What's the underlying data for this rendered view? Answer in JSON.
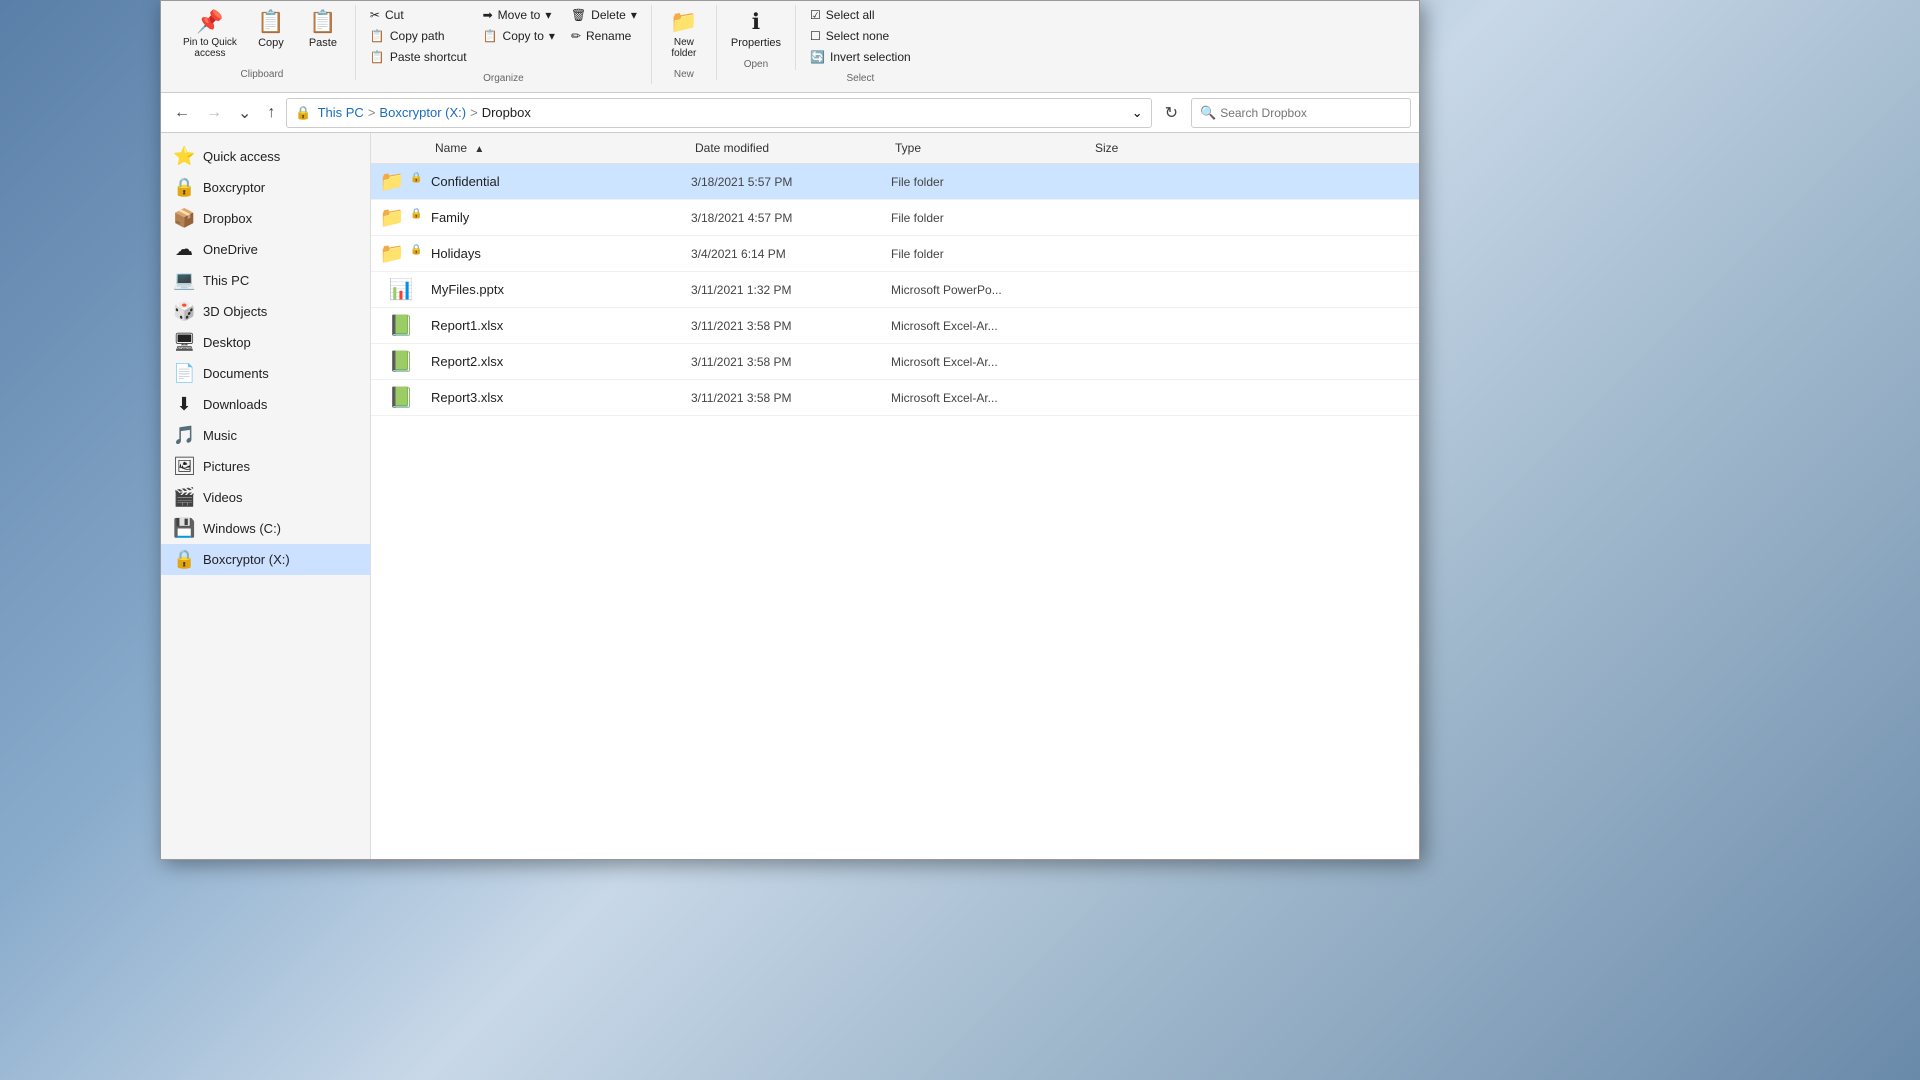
{
  "window": {
    "title": "Dropbox"
  },
  "ribbon": {
    "clipboard_label": "Clipboard",
    "organize_label": "Organize",
    "new_label": "New",
    "open_label": "Open",
    "select_label": "Select",
    "pin_label": "Pin to Quick\naccess",
    "copy_label": "Copy",
    "paste_label": "Paste",
    "cut_label": "Cut",
    "copy_path_label": "Copy path",
    "paste_shortcut_label": "Paste shortcut",
    "move_to_label": "Move to",
    "copy_to_label": "Copy to",
    "delete_label": "Delete",
    "rename_label": "Rename",
    "new_folder_label": "New\nfolder",
    "properties_label": "Properties",
    "select_all_label": "Select all",
    "select_none_label": "Select none",
    "invert_selection_label": "Invert selection"
  },
  "addressbar": {
    "this_pc": "This PC",
    "boxcryptor": "Boxcryptor (X:)",
    "dropbox": "Dropbox",
    "search_placeholder": "Search Dropbox"
  },
  "sidebar": {
    "items": [
      {
        "id": "quick-access",
        "label": "Quick access",
        "icon": "⭐"
      },
      {
        "id": "boxcryptor",
        "label": "Boxcryptor",
        "icon": "🔒"
      },
      {
        "id": "dropbox",
        "label": "Dropbox",
        "icon": "📦"
      },
      {
        "id": "onedrive",
        "label": "OneDrive",
        "icon": "☁"
      },
      {
        "id": "this-pc",
        "label": "This PC",
        "icon": "💻"
      },
      {
        "id": "3d-objects",
        "label": "3D Objects",
        "icon": "🎲"
      },
      {
        "id": "desktop",
        "label": "Desktop",
        "icon": "🖥"
      },
      {
        "id": "documents",
        "label": "Documents",
        "icon": "📄"
      },
      {
        "id": "downloads",
        "label": "Downloads",
        "icon": "⬇"
      },
      {
        "id": "music",
        "label": "Music",
        "icon": "🎵"
      },
      {
        "id": "pictures",
        "label": "Pictures",
        "icon": "🖼"
      },
      {
        "id": "videos",
        "label": "Videos",
        "icon": "🎬"
      },
      {
        "id": "windows-c",
        "label": "Windows (C:)",
        "icon": "💾"
      },
      {
        "id": "boxcryptor-x",
        "label": "Boxcryptor (X:)",
        "icon": "🔒",
        "active": true
      }
    ]
  },
  "columns": {
    "name": "Name",
    "date_modified": "Date modified",
    "type": "Type",
    "size": "Size",
    "sort_arrow": "▲"
  },
  "files": [
    {
      "id": "confidential",
      "name": "Confidential",
      "date": "3/18/2021 5:57 PM",
      "type": "File folder",
      "size": "",
      "icon": "📁",
      "selected": true
    },
    {
      "id": "family",
      "name": "Family",
      "date": "3/18/2021 4:57 PM",
      "type": "File folder",
      "size": "",
      "icon": "📁",
      "selected": false
    },
    {
      "id": "holidays",
      "name": "Holidays",
      "date": "3/4/2021 6:14 PM",
      "type": "File folder",
      "size": "",
      "icon": "📁",
      "selected": false
    },
    {
      "id": "myfiles-pptx",
      "name": "MyFiles.pptx",
      "date": "3/11/2021 1:32 PM",
      "type": "Microsoft PowerPo...",
      "size": "",
      "icon": "📊",
      "selected": false
    },
    {
      "id": "report1-xlsx",
      "name": "Report1.xlsx",
      "date": "3/11/2021 3:58 PM",
      "type": "Microsoft Excel-Ar...",
      "size": "",
      "icon": "📗",
      "selected": false
    },
    {
      "id": "report2-xlsx",
      "name": "Report2.xlsx",
      "date": "3/11/2021 3:58 PM",
      "type": "Microsoft Excel-Ar...",
      "size": "",
      "icon": "📗",
      "selected": false
    },
    {
      "id": "report3-xlsx",
      "name": "Report3.xlsx",
      "date": "3/11/2021 3:58 PM",
      "type": "Microsoft Excel-Ar...",
      "size": "",
      "icon": "📗",
      "selected": false
    }
  ]
}
